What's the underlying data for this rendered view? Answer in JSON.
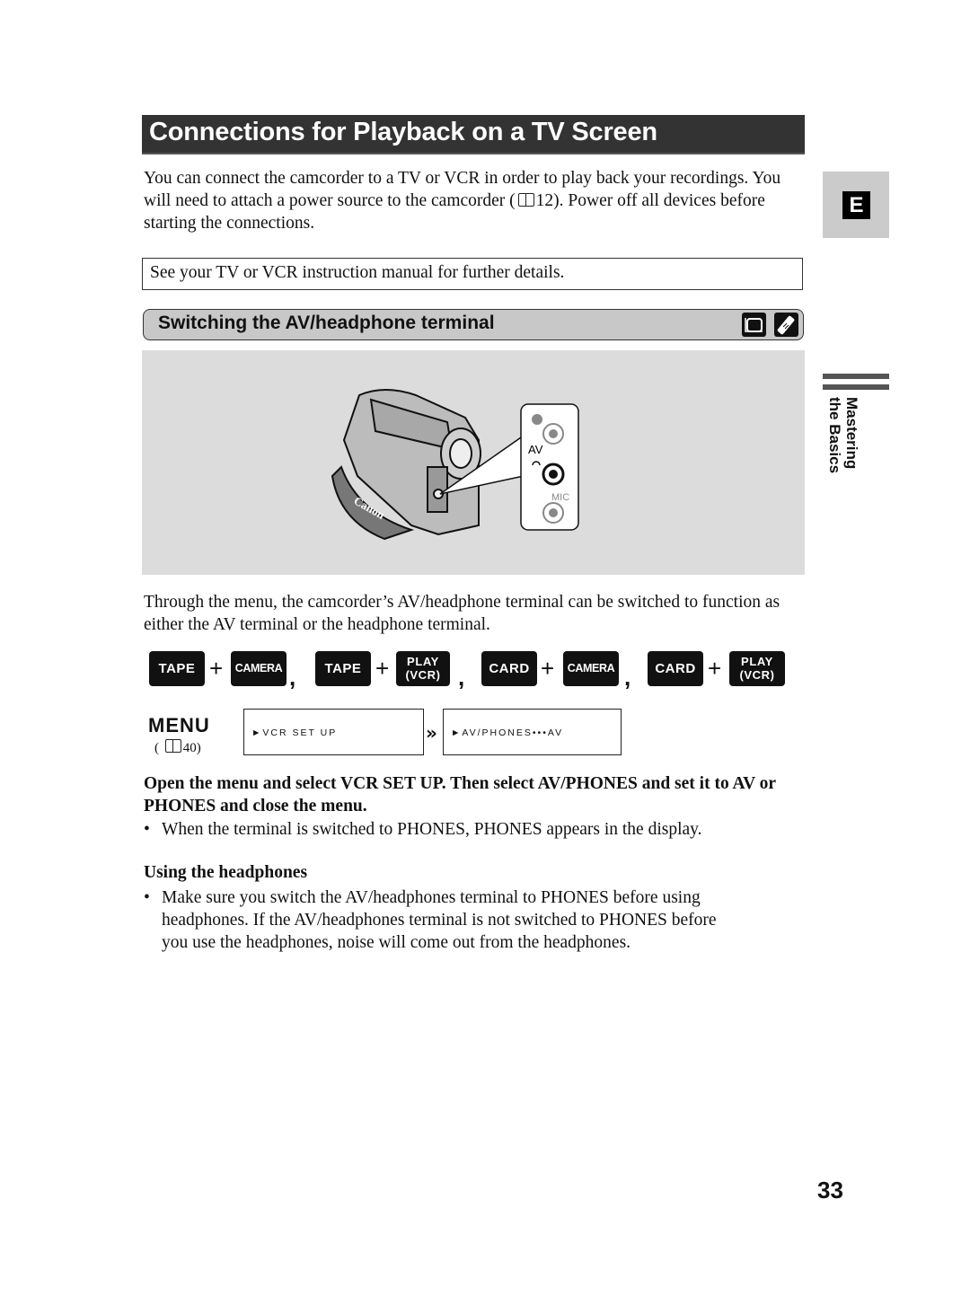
{
  "page": {
    "title": "Connections for Playback on a TV Screen",
    "intro": "You can connect the camcorder to a TV or VCR in order to play back your recordings. You will need to attach a power source to the camcorder (",
    "intro_ref": "12).",
    "intro_tail": "Power off all devices before starting the connections.",
    "note": "See your TV or VCR instruction manual for further details.",
    "language_tab": "E",
    "side_label_line1": "Mastering",
    "side_label_line2": "the Basics",
    "page_number": "33"
  },
  "section": {
    "title": "Switching the AV/headphone terminal",
    "mode_icons": [
      "camera-mode-icon",
      "remote-control-icon"
    ]
  },
  "illustration": {
    "brand": "Canon",
    "jack_labels": {
      "top": "",
      "av": "AV",
      "mic": "MIC"
    }
  },
  "body": {
    "paragraph": "Through the menu, the camcorder’s AV/headphone terminal can be switched to function as either the AV terminal or the headphone terminal."
  },
  "modes": [
    {
      "a": "TAPE",
      "b": "CAMERA"
    },
    {
      "a": "TAPE",
      "b_line1": "PLAY",
      "b_line2": "(VCR)"
    },
    {
      "a": "CARD",
      "b": "CAMERA"
    },
    {
      "a": "CARD",
      "b_line1": "PLAY",
      "b_line2": "(VCR)"
    }
  ],
  "menu": {
    "label": "MENU",
    "ref": "40)",
    "screen1": "►VCR SET UP",
    "screen2": "►AV/PHONES•••AV"
  },
  "instructions": {
    "step": "Open the menu and select VCR SET UP. Then select AV/PHONES and set it to AV or PHONES and close the menu.",
    "bullet1": "When the terminal is switched to PHONES, PHONES appears in the display.",
    "subheading": "Using the headphones",
    "bullet2_line1": "Make sure you switch the AV/headphones terminal to PHONES before using",
    "bullet2_line2": "headphones. If the AV/headphones terminal is not switched to PHONES before",
    "bullet2_line3": "you use the headphones, noise will come out from the headphones."
  }
}
